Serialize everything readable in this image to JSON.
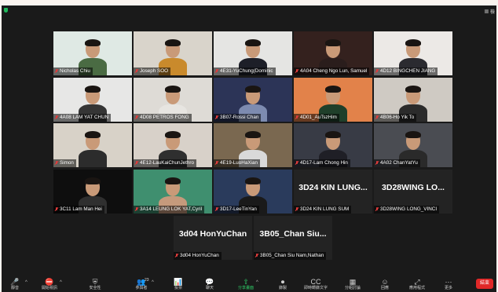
{
  "view_label": "檢",
  "participants": [
    {
      "name": "Nicholas Chiu",
      "bg": "#dfe9e4",
      "body": "#4a6b43",
      "shirt": "#4a6b43"
    },
    {
      "name": "Joseph SOO",
      "bg": "#d9d4cb",
      "body": "#c98a2c"
    },
    {
      "name": "4E31-YuChung(Dominic",
      "bg": "#e5e5e3",
      "body": "#1d1f28"
    },
    {
      "name": "4A04 Cheng Ngo Lun, Samuel",
      "bg": "#34211e",
      "body": "#2a1d1c"
    },
    {
      "name": "4D12 BINGCHEN JIANG",
      "bg": "#ece9e6",
      "body": "#2b2b30"
    },
    {
      "name": "4A08 LAM YAT CHUN",
      "bg": "#e7e7e6",
      "body": "#353535"
    },
    {
      "name": "4D08 PETROS FONG",
      "bg": "#dedbd6",
      "body": "#e7e5e1"
    },
    {
      "name": "3B07-Rossi Chan",
      "bg": "#2c3457",
      "body": "#7d8bb0"
    },
    {
      "name": "4D01_AuTszHim",
      "bg": "#e2824a",
      "body": "#1f3f2a"
    },
    {
      "name": "4B06-Ho Yik To",
      "bg": "#cfcac3",
      "body": "#2b2b2b"
    },
    {
      "name": "Simon",
      "bg": "#d8d2c8",
      "body": "#2c2c2c"
    },
    {
      "name": "4E12-LauKaiChunJethro",
      "bg": "#d8d1c9",
      "body": "#2f2f2f"
    },
    {
      "name": "4E19-LuoHaXian",
      "bg": "#7a6850",
      "body": "#d9d9d9"
    },
    {
      "name": "4D17-Lam Chong Hin",
      "bg": "#383b45",
      "body": "#1f1f26"
    },
    {
      "name": "4A02 ChanYatYu",
      "bg": "#4a4c52",
      "body": "#2a2a2a"
    },
    {
      "name": "3C11 Lam Man Hei",
      "bg": "#0e0e0e",
      "body": "#2f2f2f"
    },
    {
      "name": "3A14 LEUNG LOK YAT,Cyril",
      "bg": "#3f8f6f",
      "body": "#c59a7c"
    },
    {
      "name": "3D17-LeeTinYan",
      "bg": "#2a3b5c",
      "body": "#1a1a1a"
    },
    {
      "name": "3D24 KIN LUNG SUM",
      "big": "3D24  KIN  LUNG..."
    },
    {
      "name": "3D28WING LONG_VINCI",
      "big": "3D28WING  LO..."
    },
    {
      "name": "3d04 HonYuChan",
      "big": "3d04  HonYuChan"
    },
    {
      "name": "3B05_Chan Siu Nam,Nathan",
      "big": "3B05_Chan  Siu..."
    }
  ],
  "toolbar": [
    {
      "icon": "🎤",
      "label": "靜音"
    },
    {
      "icon": "⛔",
      "label": "開始視訊"
    },
    {
      "icon": "⛨",
      "label": "安全性"
    },
    {
      "icon": "👥",
      "label": "參與者"
    },
    {
      "icon": "📊",
      "label": "投票"
    },
    {
      "icon": "💬",
      "label": "聊天"
    },
    {
      "icon": "⇧",
      "label": "分享畫面"
    },
    {
      "icon": "⏺",
      "label": "錄製"
    },
    {
      "icon": "CC",
      "label": "即時轉錄文字"
    },
    {
      "icon": "▦",
      "label": "分組討論"
    },
    {
      "icon": "☺",
      "label": "回應"
    },
    {
      "icon": "⤢",
      "label": "應用程式"
    },
    {
      "icon": "⋯",
      "label": "更多"
    }
  ],
  "participant_count": "23",
  "end_label": "結束"
}
